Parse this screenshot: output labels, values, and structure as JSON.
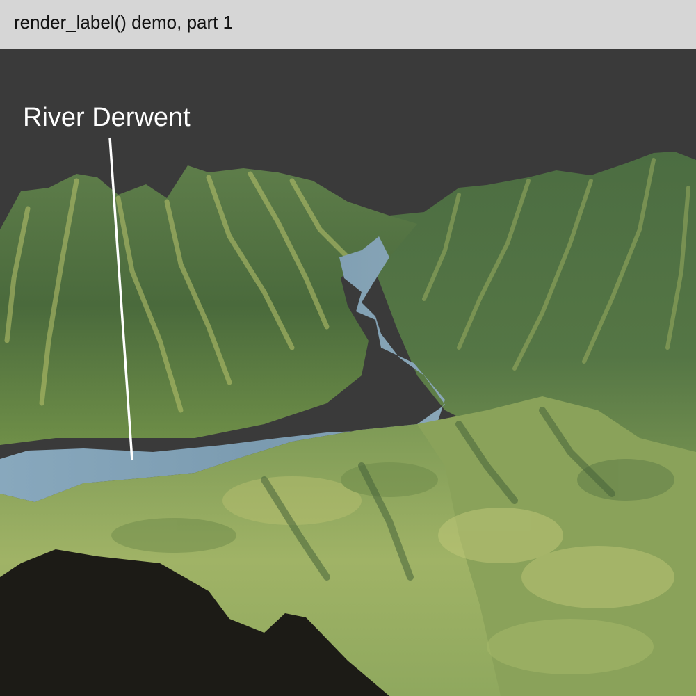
{
  "window": {
    "title": "render_label() demo, part 1"
  },
  "scene": {
    "label": "River Derwent",
    "colors": {
      "sky": "#3a3a3a",
      "void": "#1c1b16",
      "water": "#7e9db3",
      "terrain_dark": "#3f5d3a",
      "terrain_mid": "#5d7f45",
      "terrain_light": "#a9b763",
      "leader_line": "#ffffff"
    }
  }
}
